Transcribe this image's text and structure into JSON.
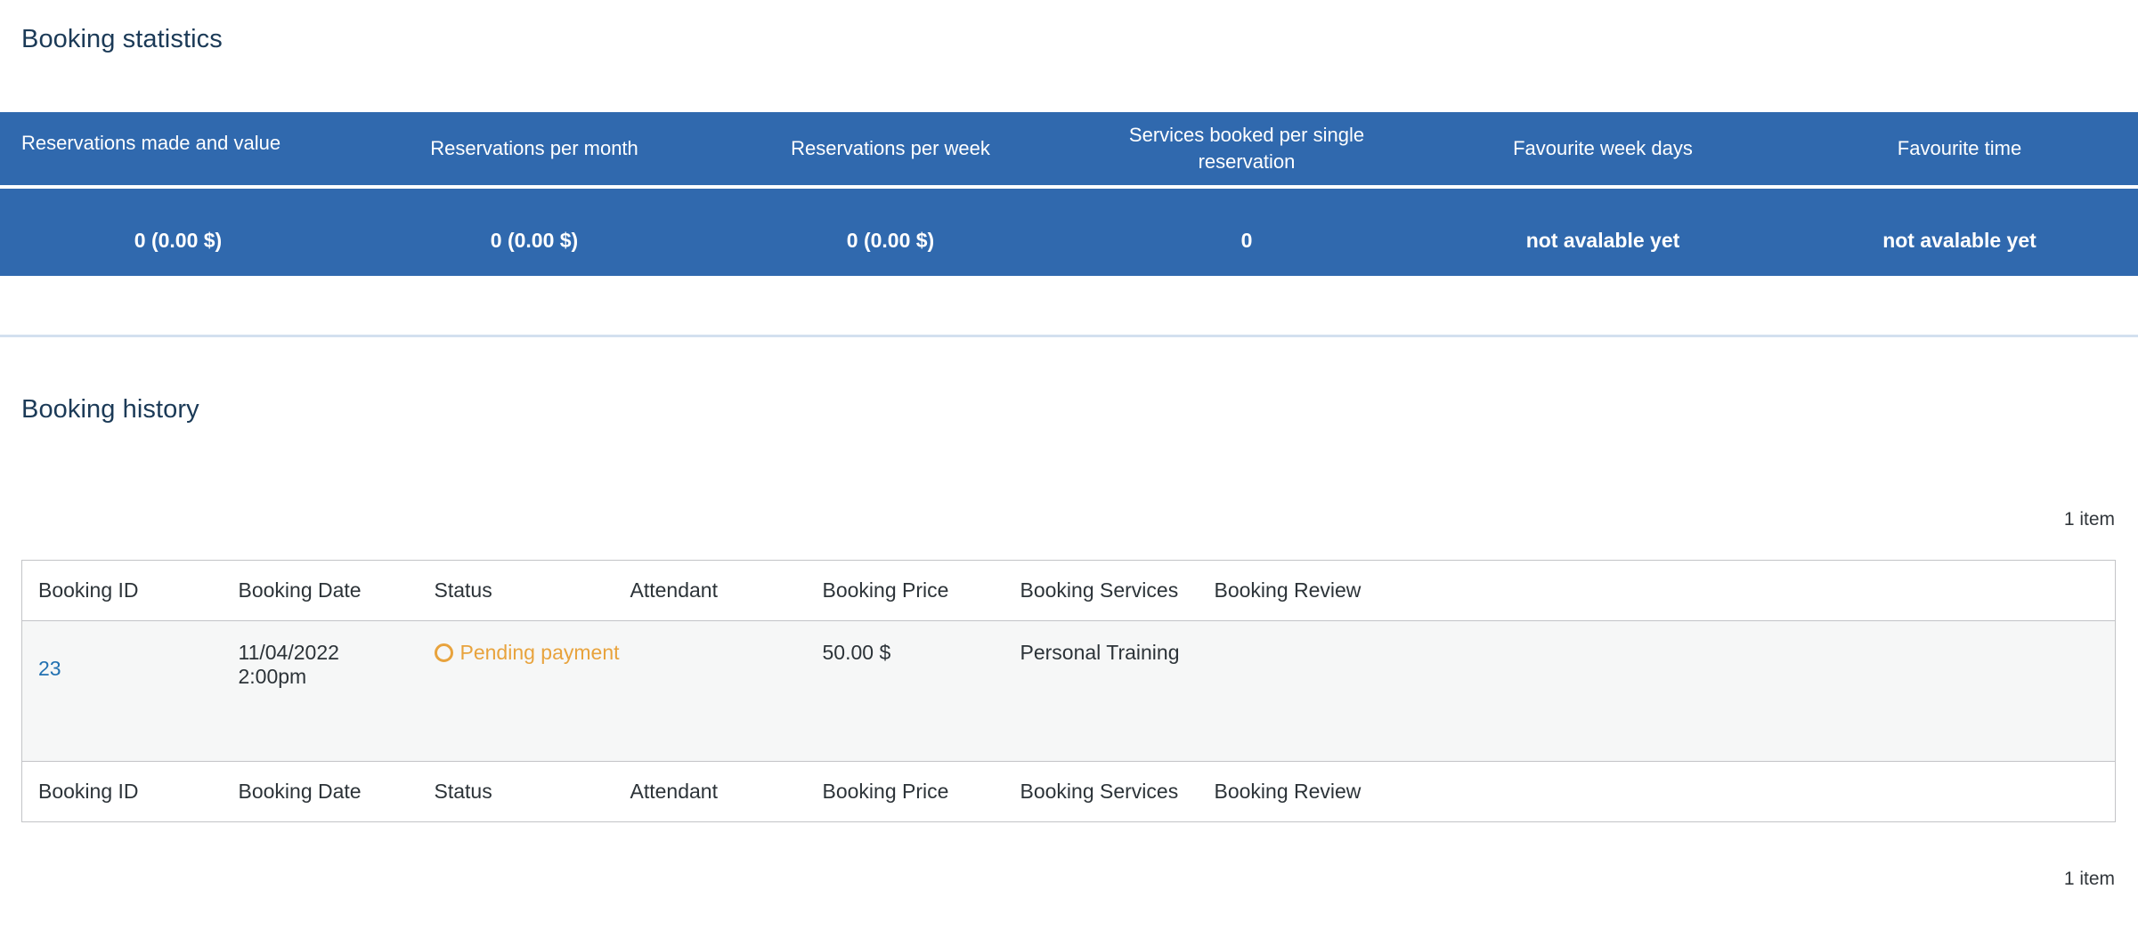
{
  "stats": {
    "title": "Booking statistics",
    "columns": [
      "Reservations made and value",
      "Reservations per month",
      "Reservations per week",
      "Services booked per single reservation",
      "Favourite week days",
      "Favourite time"
    ],
    "values": [
      "0 (0.00 $)",
      "0 (0.00 $)",
      "0 (0.00 $)",
      "0",
      "not avalable yet",
      "not avalable yet"
    ],
    "header_bg": "#3069ae",
    "header_text": "#ffffff"
  },
  "history": {
    "title": "Booking history",
    "item_count_top": "1 item",
    "item_count_bottom": "1 item",
    "columns": [
      "Booking ID",
      "Booking Date",
      "Status",
      "Attendant",
      "Booking Price",
      "Booking Services",
      "Booking Review"
    ],
    "rows": [
      {
        "id": "23",
        "date": "11/04/2022 2:00pm",
        "status": "Pending payment",
        "status_color": "#e8a33d",
        "status_icon": "circle-outline-icon",
        "attendant": "",
        "price": "50.00 $",
        "services": "Personal Training",
        "review": ""
      }
    ]
  }
}
